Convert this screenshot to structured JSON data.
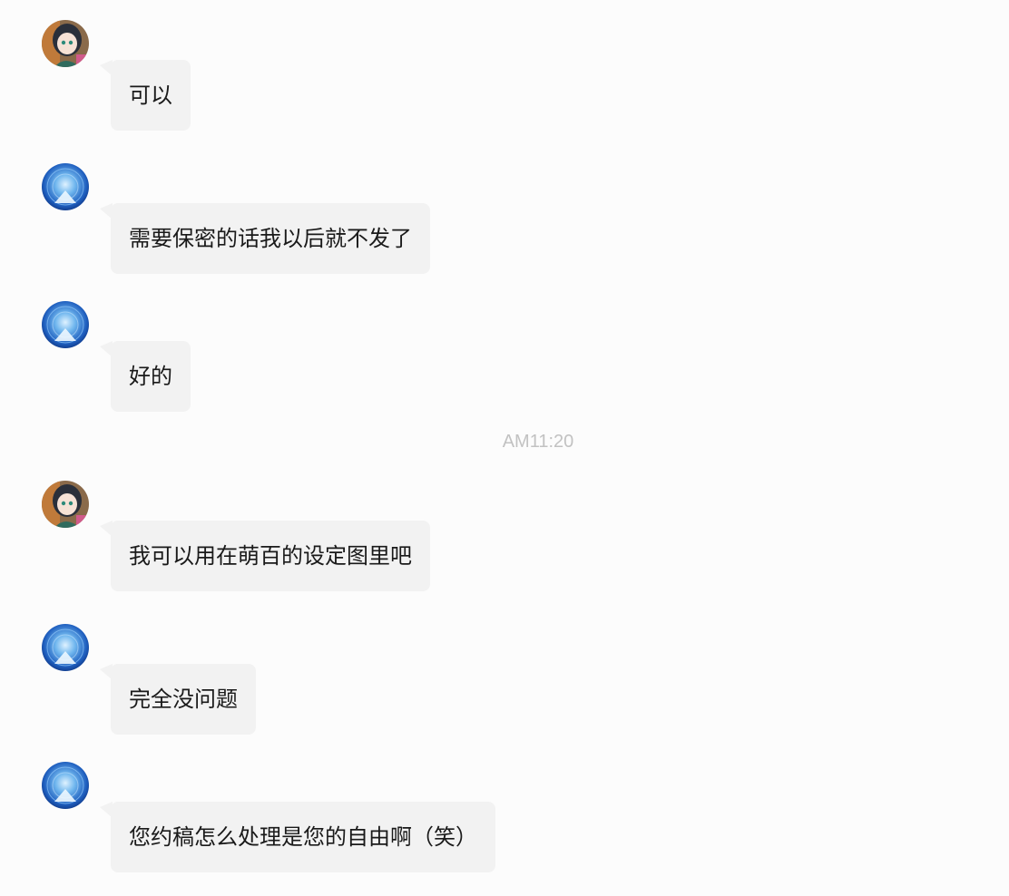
{
  "messages": [
    {
      "sender": "anime-girl",
      "text": "可以"
    },
    {
      "sender": "blue-orb",
      "text": "需要保密的话我以后就不发了"
    },
    {
      "sender": "blue-orb",
      "text": "好的"
    },
    {
      "sender": "anime-girl",
      "text": "我可以用在萌百的设定图里吧"
    },
    {
      "sender": "blue-orb",
      "text": "完全没问题"
    },
    {
      "sender": "blue-orb",
      "text": "您约稿怎么处理是您的自由啊（笑）"
    }
  ],
  "timestamp": "AM11:20",
  "colors": {
    "background": "#fcfcfc",
    "bubble": "#f2f2f2",
    "text": "#1a1a1a",
    "timestamp": "#c2c2c2"
  }
}
